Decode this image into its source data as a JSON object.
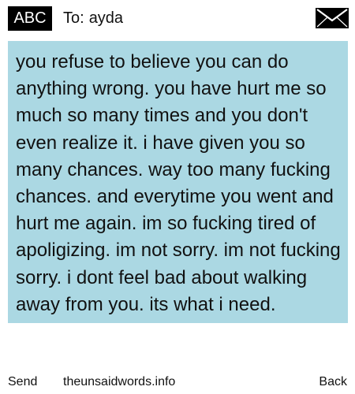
{
  "header": {
    "badge": "ABC",
    "to_label": "To:",
    "recipient": "ayda",
    "envelope_icon": "envelope-icon"
  },
  "message": {
    "body": "you refuse to believe you can do anything wrong. you have hurt me so much so many times and you don't even realize it. i have given you so many chances. way too many fucking chances. and everytime you went and hurt me again. im so fucking tired of apoligizing. im not sorry. im not fucking sorry. i dont feel bad about walking away from you. its what i need.",
    "highlight_color": "#abd8e3"
  },
  "footer": {
    "send_label": "Send",
    "site": "theunsaidwords.info",
    "back_label": "Back"
  }
}
